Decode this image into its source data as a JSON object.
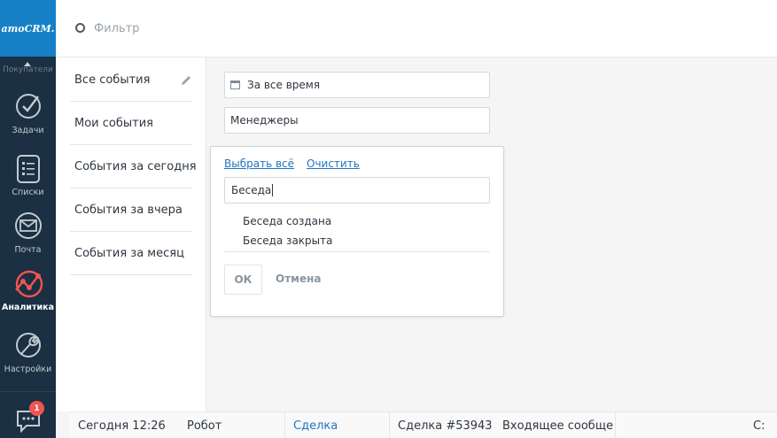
{
  "nav": {
    "logo": "amoCRM.",
    "top_label": "Покупатели",
    "items": [
      {
        "label": "Задачи",
        "icon": "check-icon"
      },
      {
        "label": "Списки",
        "icon": "list-icon"
      },
      {
        "label": "Почта",
        "icon": "mail-icon"
      },
      {
        "label": "Аналитика",
        "icon": "analytics-icon",
        "active": true
      },
      {
        "label": "Настройки",
        "icon": "wrench-icon"
      }
    ],
    "chat_badge": "1"
  },
  "topbar": {
    "filter_placeholder": "Фильтр"
  },
  "presets": [
    {
      "label": "Все события"
    },
    {
      "label": "Мои события"
    },
    {
      "label": "События за сегодня"
    },
    {
      "label": "События за вчера"
    },
    {
      "label": "События за месяц"
    }
  ],
  "filters": {
    "date": "За все время",
    "managers": "Менеджеры"
  },
  "dropdown": {
    "select_all": "Выбрать всё",
    "clear": "Очистить",
    "search_value": "Беседа",
    "options": [
      "Беседа создана",
      "Беседа закрыта"
    ],
    "ok": "ОК",
    "cancel": "Отмена"
  },
  "event_row": {
    "time": "Сегодня 12:26",
    "author": "Робот",
    "entity": "Сделка",
    "name": "Сделка #53943",
    "type": "Входящее сообщен",
    "value": "С:"
  },
  "colors": {
    "nav_bg": "#1b3042",
    "logo_bg": "#1580c5",
    "link": "#1f75c0",
    "analytics_accent": "#f0544f"
  }
}
